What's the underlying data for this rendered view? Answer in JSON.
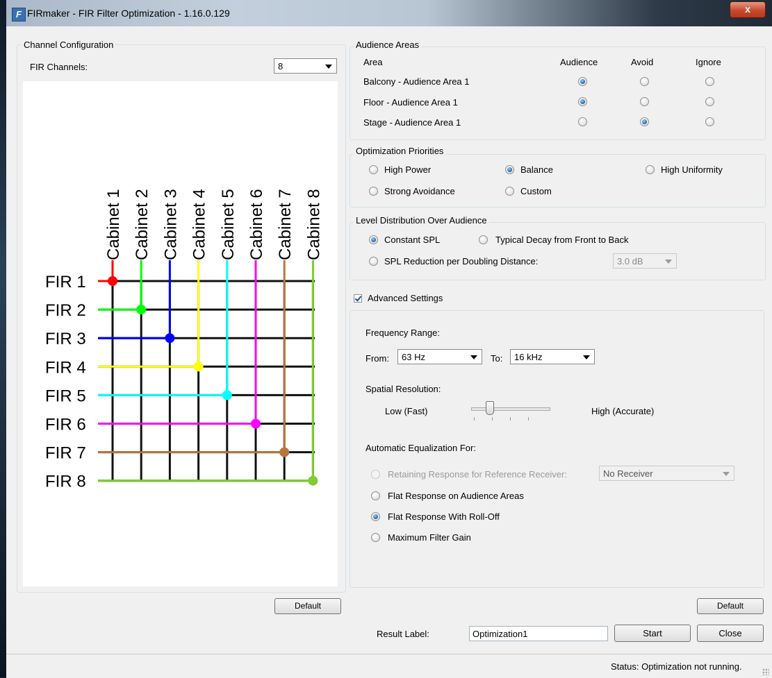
{
  "window": {
    "title": "FIRmaker - FIR Filter Optimization - 1.16.0.129",
    "close_glyph": "x"
  },
  "channel_config": {
    "legend": "Channel Configuration",
    "fir_channels_label": "FIR Channels:",
    "fir_channels_value": "8",
    "default_label": "Default",
    "diagram": {
      "cabinets": [
        "Cabinet 1",
        "Cabinet 2",
        "Cabinet 3",
        "Cabinet 4",
        "Cabinet 5",
        "Cabinet 6",
        "Cabinet 7",
        "Cabinet 8"
      ],
      "firs": [
        "FIR 1",
        "FIR 2",
        "FIR 3",
        "FIR 4",
        "FIR 5",
        "FIR 6",
        "FIR 7",
        "FIR 8"
      ],
      "colors": [
        "#ff0000",
        "#00ff00",
        "#0000ff",
        "#ffff00",
        "#00ffff",
        "#ff00ff",
        "#b8763c",
        "#7fcc33"
      ]
    }
  },
  "audience_areas": {
    "legend": "Audience Areas",
    "headers": {
      "area": "Area",
      "audience": "Audience",
      "avoid": "Avoid",
      "ignore": "Ignore"
    },
    "rows": [
      {
        "name": "Balcony - Audience Area 1",
        "selected": "audience"
      },
      {
        "name": "Floor - Audience Area 1",
        "selected": "audience"
      },
      {
        "name": "Stage - Audience Area 1",
        "selected": "avoid"
      }
    ]
  },
  "optimization_priorities": {
    "legend": "Optimization Priorities",
    "options": {
      "high_power": "High Power",
      "balance": "Balance",
      "high_uniformity": "High Uniformity",
      "strong_avoidance": "Strong Avoidance",
      "custom": "Custom"
    },
    "selected": "balance"
  },
  "level_distribution": {
    "legend": "Level Distribution Over Audience",
    "constant_spl": "Constant SPL",
    "typical_decay": "Typical Decay from Front to Back",
    "spl_reduction": "SPL Reduction per Doubling Distance:",
    "spl_reduction_value": "3.0 dB",
    "selected": "constant_spl"
  },
  "advanced": {
    "checkbox_label": "Advanced Settings",
    "checked": true,
    "frequency_range_label": "Frequency Range:",
    "from_label": "From:",
    "from_value": "63 Hz",
    "to_label": "To:",
    "to_value": "16 kHz",
    "spatial_resolution_label": "Spatial Resolution:",
    "low_label": "Low (Fast)",
    "high_label": "High (Accurate)",
    "slider_position": 0.25,
    "auto_eq_label": "Automatic Equalization For:",
    "retaining_label": "Retaining Response for Reference Receiver:",
    "receiver_value": "No Receiver",
    "flat_audience_label": "Flat Response on Audience Areas",
    "flat_rolloff_label": "Flat Response With Roll-Off",
    "max_gain_label": "Maximum Filter Gain",
    "selected_eq": "flat_rolloff",
    "default_label": "Default"
  },
  "footer": {
    "result_label": "Result Label:",
    "result_value": "Optimization1",
    "start_label": "Start",
    "close_label": "Close",
    "status": "Status: Optimization not running."
  }
}
